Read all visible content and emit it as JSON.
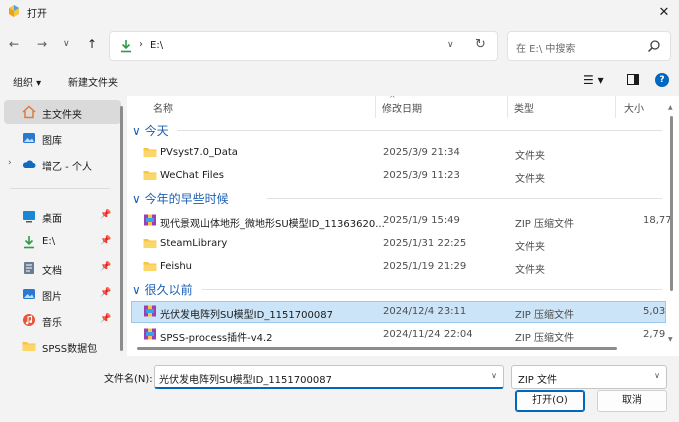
{
  "window": {
    "title": "打开",
    "close": "✕"
  },
  "nav": {
    "back": "←",
    "forward": "→",
    "recent": "∨",
    "up": "↑"
  },
  "address": {
    "separator": "›",
    "path": "E:\\",
    "dropdown": "∨",
    "refresh": "↻"
  },
  "search": {
    "placeholder": "在 E:\\ 中搜索"
  },
  "toolbar": {
    "organize": "组织 ▾",
    "new_folder": "新建文件夹",
    "view": "☰ ▾"
  },
  "sidebar": {
    "items": [
      {
        "label": "主文件夹",
        "icon": "home-icon"
      },
      {
        "label": "图库",
        "icon": "gallery-icon"
      },
      {
        "label": "增乙 - 个人",
        "icon": "cloud-icon",
        "chevron": "›"
      },
      {
        "label": "桌面",
        "icon": "desktop-icon",
        "pin": "📌"
      },
      {
        "label": "E:\\",
        "icon": "download-icon",
        "pin": "📌"
      },
      {
        "label": "文档",
        "icon": "documents-icon",
        "pin": "📌"
      },
      {
        "label": "图片",
        "icon": "pictures-icon",
        "pin": "📌"
      },
      {
        "label": "音乐",
        "icon": "music-icon",
        "pin": "📌"
      },
      {
        "label": "SPSS数据包",
        "icon": "folder-icon"
      }
    ]
  },
  "columns": {
    "name": "名称",
    "date": "修改日期",
    "type": "类型",
    "size": "大小",
    "sort_arrow": "^"
  },
  "groups": [
    {
      "label": "今天",
      "chev": "∨"
    },
    {
      "label": "今年的早些时候",
      "chev": "∨"
    },
    {
      "label": "很久以前",
      "chev": "∨"
    }
  ],
  "files": [
    {
      "name": "PVsyst7.0_Data",
      "date": "2025/3/9 21:34",
      "type": "文件夹",
      "size": "",
      "kind": "folder"
    },
    {
      "name": "WeChat Files",
      "date": "2025/3/9 11:23",
      "type": "文件夹",
      "size": "",
      "kind": "folder"
    },
    {
      "name": "现代景观山体地形_微地形SU模型ID_11363620...",
      "date": "2025/1/9 15:49",
      "type": "ZIP 压缩文件",
      "size": "18,77",
      "kind": "zip"
    },
    {
      "name": "SteamLibrary",
      "date": "2025/1/31 22:25",
      "type": "文件夹",
      "size": "",
      "kind": "folder"
    },
    {
      "name": "Feishu",
      "date": "2025/1/19 21:29",
      "type": "文件夹",
      "size": "",
      "kind": "folder"
    },
    {
      "name": "光伏发电阵列SU模型ID_1151700087",
      "date": "2024/12/4 23:11",
      "type": "ZIP 压缩文件",
      "size": "5,03",
      "kind": "zip"
    },
    {
      "name": "SPSS-process插件-v4.2",
      "date": "2024/11/24 22:04",
      "type": "ZIP 压缩文件",
      "size": "2,79",
      "kind": "zip"
    }
  ],
  "footer": {
    "filename_label": "文件名(N):",
    "filename_value": "光伏发电阵列SU模型ID_1151700087",
    "filetype_value": "ZIP 文件",
    "dropdown": "∨",
    "open_button": "打开(O)",
    "cancel_button": "取消"
  },
  "colors": {
    "accent": "#0067c0",
    "folder": "#f7c544",
    "selection": "#cce4f7",
    "group_text": "#1a5fb4"
  }
}
